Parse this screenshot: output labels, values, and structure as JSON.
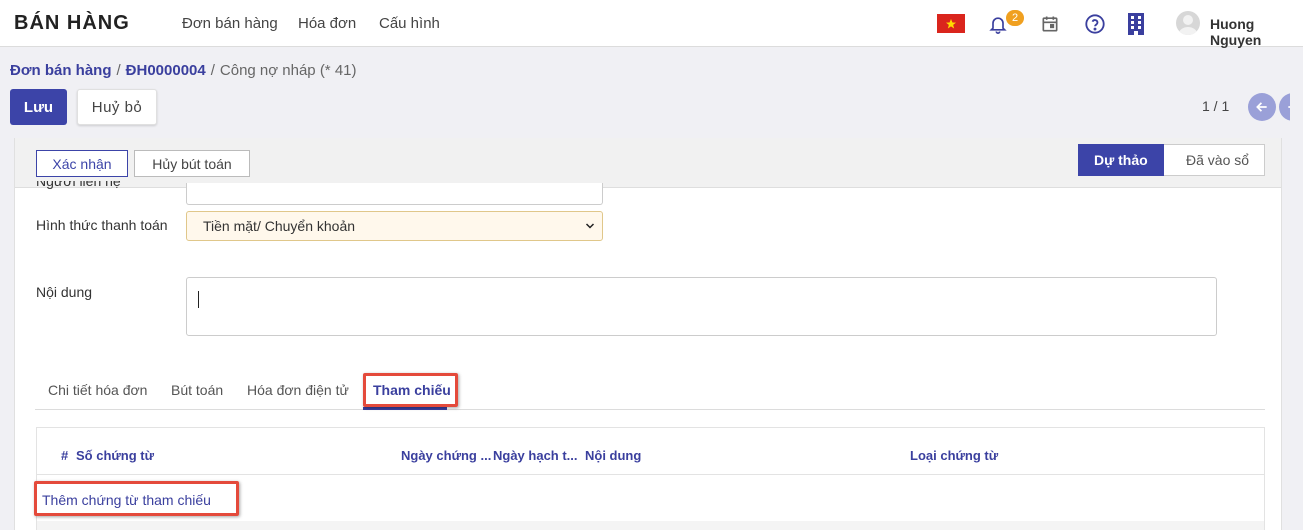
{
  "app": {
    "title": "BÁN HÀNG"
  },
  "menu": [
    {
      "label": "Đơn bán hàng"
    },
    {
      "label": "Hóa đơn"
    },
    {
      "label": "Cấu hình"
    }
  ],
  "topbar": {
    "notification_count": "2",
    "user_name": "Huong Nguyen"
  },
  "breadcrumb": {
    "items": [
      "Đơn bán hàng",
      "ĐH0000004"
    ],
    "current": "Công nợ nháp (* 41)",
    "separator": "/"
  },
  "actions": {
    "save": "Lưu",
    "discard": "Huỷ bỏ"
  },
  "pager": {
    "value": "1 / 1"
  },
  "statusbar": {
    "confirm": "Xác nhận",
    "cancel_entry": "Hủy bút toán",
    "stages": [
      "Dự thảo",
      "Đã vào sổ"
    ],
    "active_stage": "Dự thảo"
  },
  "form": {
    "contact_label": "Người liên hệ",
    "payment_label": "Hình thức thanh toán",
    "payment_value": "Tiền mặt/ Chuyển khoản",
    "content_label": "Nội dung",
    "content_value": ""
  },
  "tabs": [
    {
      "label": "Chi tiết hóa đơn"
    },
    {
      "label": "Bút toán"
    },
    {
      "label": "Hóa đơn điện tử"
    },
    {
      "label": "Tham chiếu"
    }
  ],
  "active_tab": "Tham chiếu",
  "reference_table": {
    "columns": [
      "#",
      "Số chứng từ",
      "Ngày chứng ...",
      "Ngày hạch t...",
      "Nội dung",
      "Loại chứng từ"
    ],
    "add_line": "Thêm chứng từ tham chiếu",
    "rows": []
  },
  "colors": {
    "primary": "#3c44a8",
    "highlight": "#e44a3b",
    "badge": "#f0a020"
  }
}
